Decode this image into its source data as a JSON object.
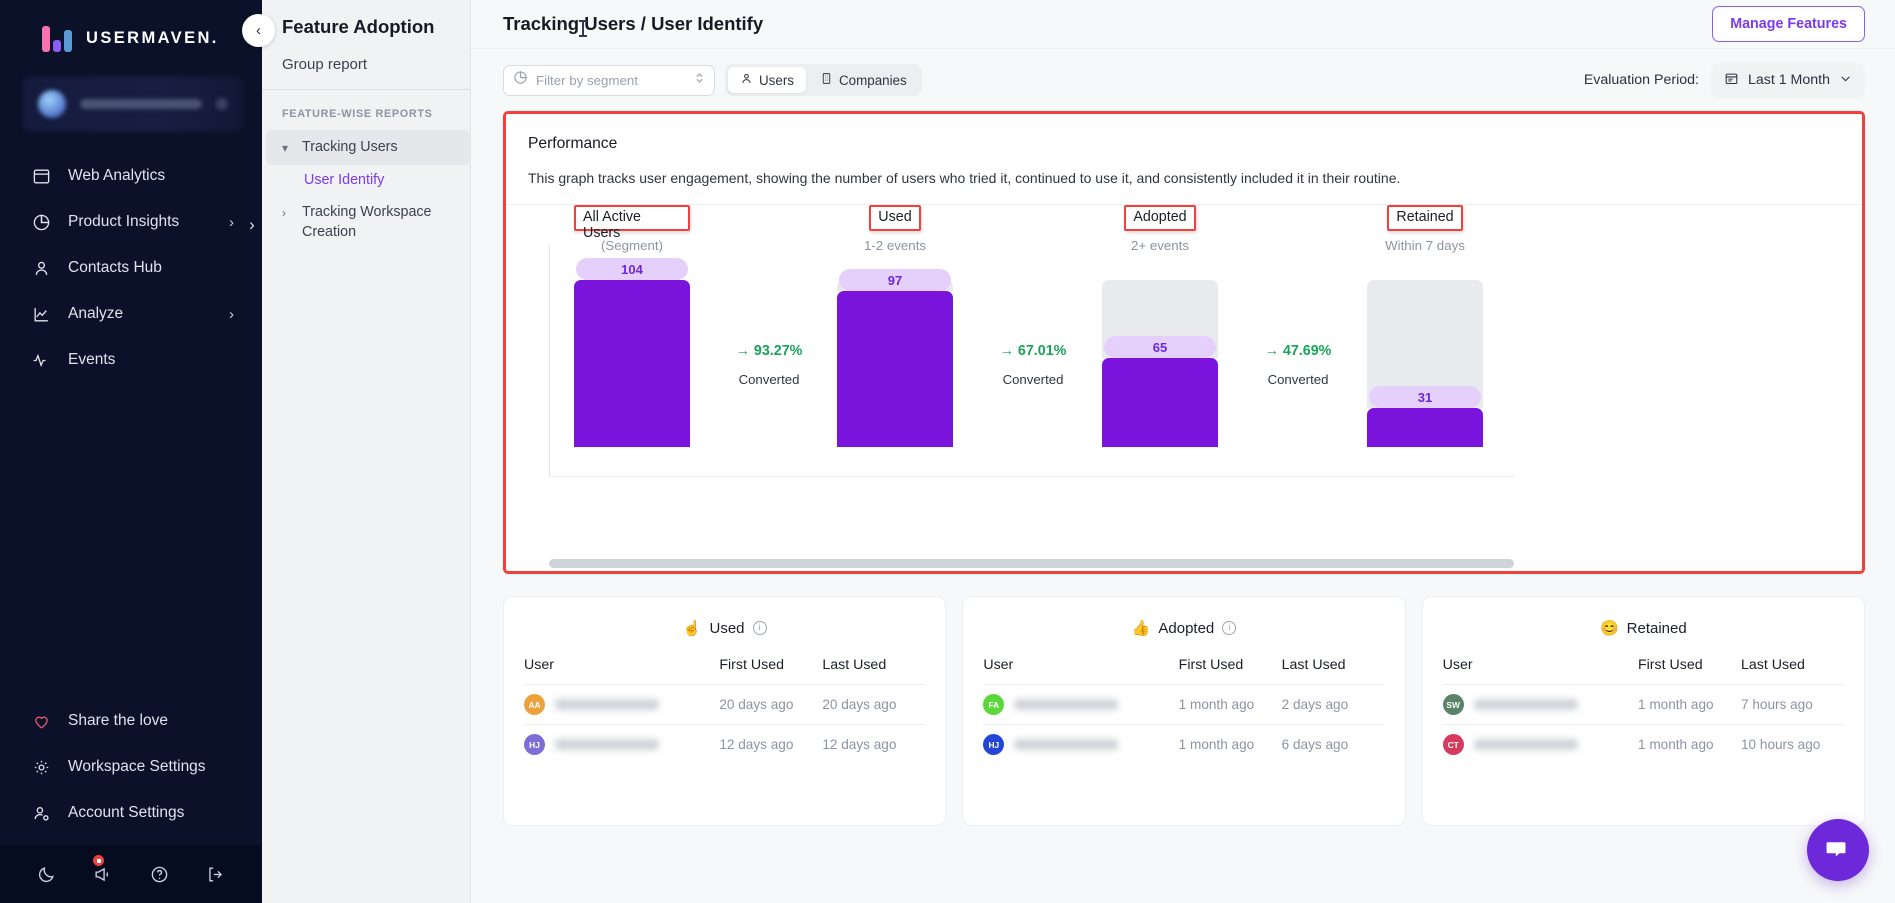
{
  "sidebar": {
    "brand": "USERMAVEN.",
    "nav_items": [
      {
        "label": "Web Analytics",
        "icon": "browser-icon",
        "has_chevron": false
      },
      {
        "label": "Product Insights",
        "icon": "pie-chart-icon",
        "has_chevron": true
      },
      {
        "label": "Contacts Hub",
        "icon": "person-icon",
        "has_chevron": false
      },
      {
        "label": "Analyze",
        "icon": "chart-area-icon",
        "has_chevron": true
      },
      {
        "label": "Events",
        "icon": "pulse-icon",
        "has_chevron": false
      }
    ],
    "bottom_items": [
      {
        "label": "Share the love",
        "icon": "heart-icon"
      },
      {
        "label": "Workspace Settings",
        "icon": "gear-icon"
      },
      {
        "label": "Account Settings",
        "icon": "user-gear-icon"
      }
    ],
    "footer_icons": [
      "moon-icon",
      "megaphone-icon",
      "help-circle-icon",
      "logout-icon"
    ]
  },
  "subpanel": {
    "title": "Feature Adoption",
    "group_report": "Group report",
    "section_heading": "FEATURE-WISE REPORTS",
    "items": [
      {
        "label": "Tracking Users",
        "expanded": true,
        "active": true
      },
      {
        "label": "Tracking Workspace Creation",
        "expanded": false,
        "active": false
      }
    ],
    "leaf": "User Identify"
  },
  "header": {
    "title": "Tracking Users / User Identify",
    "manage_features": "Manage Features"
  },
  "controls": {
    "segment_placeholder": "Filter by segment",
    "toggle": {
      "users": "Users",
      "companies": "Companies",
      "selected": "Users"
    },
    "eval_label": "Evaluation Period:",
    "period_value": "Last 1 Month"
  },
  "performance": {
    "title": "Performance",
    "description": "This graph tracks user engagement, showing the number of users who tried it, continued to use it, and consistently included it in their routine."
  },
  "chart_data": {
    "type": "bar",
    "title": "Performance",
    "categories": [
      "All Active Users",
      "Used",
      "Adopted",
      "Retained"
    ],
    "subtitles": [
      "(Segment)",
      "1-2 events",
      "2+ events",
      "Within 7 days"
    ],
    "values": [
      104,
      97,
      65,
      31
    ],
    "baseline": 104,
    "ylim": [
      0,
      104
    ],
    "grid": false,
    "legend": null,
    "bar_color": "#7a14dd",
    "ghost_color": "#e9eaee",
    "pill_color": "#e4d0fb",
    "conversions": [
      {
        "pct": "93.27%",
        "label": "Converted"
      },
      {
        "pct": "67.01%",
        "label": "Converted"
      },
      {
        "pct": "47.69%",
        "label": "Converted"
      }
    ],
    "conversion_color": "#18a558"
  },
  "cards": [
    {
      "emoji": "☝",
      "title": "Used",
      "has_info": true,
      "columns": [
        "User",
        "First Used",
        "Last Used"
      ],
      "rows": [
        {
          "initials": "AA",
          "color": "#eda13a",
          "first_used": "20 days ago",
          "last_used": "20 days ago"
        },
        {
          "initials": "HJ",
          "color": "#7b6fd4",
          "first_used": "12 days ago",
          "last_used": "12 days ago"
        }
      ]
    },
    {
      "emoji": "👍",
      "title": "Adopted",
      "has_info": true,
      "columns": [
        "User",
        "First Used",
        "Last Used"
      ],
      "rows": [
        {
          "initials": "FA",
          "color": "#5ad83a",
          "first_used": "1 month ago",
          "last_used": "2 days ago"
        },
        {
          "initials": "HJ",
          "color": "#2546d4",
          "first_used": "1 month ago",
          "last_used": "6 days ago"
        }
      ]
    },
    {
      "emoji": "😊",
      "title": "Retained",
      "has_info": false,
      "columns": [
        "User",
        "First Used",
        "Last Used"
      ],
      "rows": [
        {
          "initials": "SW",
          "color": "#5a8468",
          "first_used": "1 month ago",
          "last_used": "7 hours ago"
        },
        {
          "initials": "CT",
          "color": "#d83a5e",
          "first_used": "1 month ago",
          "last_used": "10 hours ago"
        }
      ]
    }
  ]
}
